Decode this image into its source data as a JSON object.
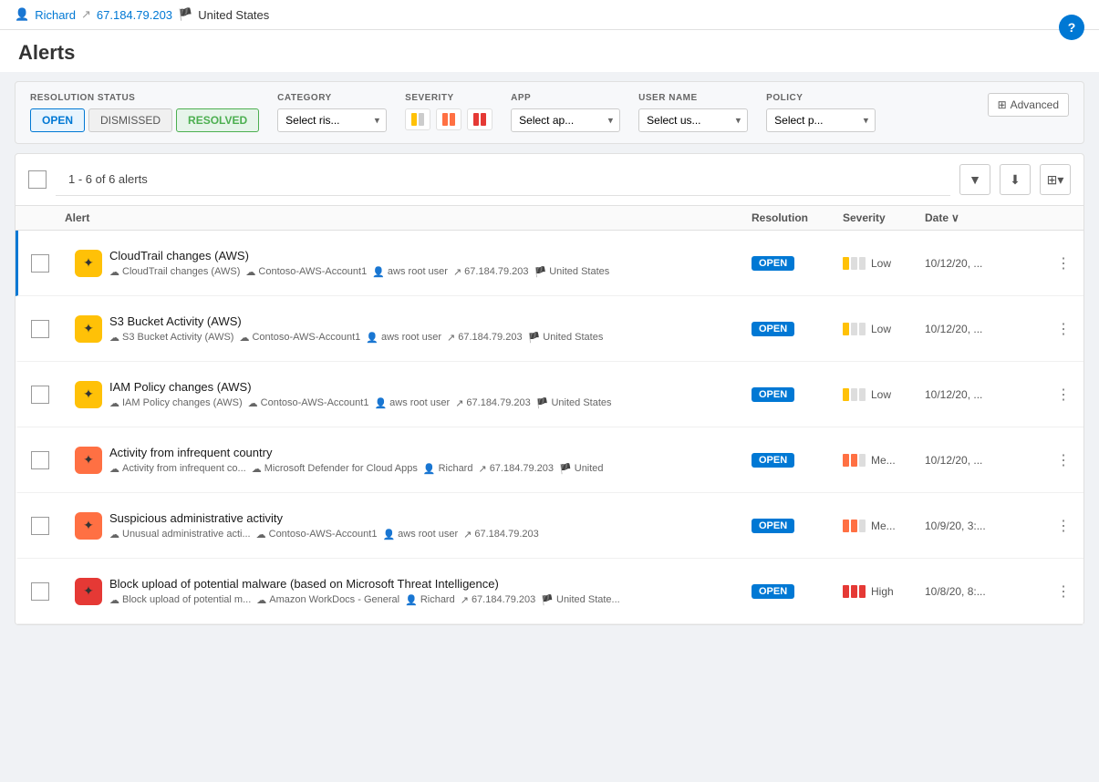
{
  "page": {
    "title": "Alerts",
    "help_label": "?"
  },
  "user": {
    "name": "Richard",
    "ip": "67.184.79.203",
    "location": "United States"
  },
  "filters": {
    "resolution_label": "RESOLUTION STATUS",
    "category_label": "CATEGORY",
    "severity_label": "SEVERITY",
    "app_label": "APP",
    "username_label": "USER NAME",
    "policy_label": "POLICY",
    "advanced_label": "Advanced",
    "open_label": "OPEN",
    "dismissed_label": "DISMISSED",
    "resolved_label": "RESOLVED",
    "category_placeholder": "Select ris...",
    "app_placeholder": "Select ap...",
    "username_placeholder": "Select us...",
    "policy_placeholder": "Select p..."
  },
  "table": {
    "count_text": "1 - 6 of 6 alerts",
    "col_alert": "Alert",
    "col_resolution": "Resolution",
    "col_severity": "Severity",
    "col_date": "Date",
    "alerts": [
      {
        "id": 1,
        "title": "CloudTrail changes (AWS)",
        "meta_policy": "CloudTrail changes (AWS)",
        "meta_app": "Contoso-AWS-Account1",
        "meta_user": "aws root user",
        "meta_ip": "67.184.79.203",
        "meta_location": "United States",
        "resolution": "OPEN",
        "severity": "Low",
        "severity_level": 1,
        "severity_color": "yellow",
        "date": "10/12/20, ...",
        "icon_color": "yellow"
      },
      {
        "id": 2,
        "title": "S3 Bucket Activity (AWS)",
        "meta_policy": "S3 Bucket Activity (AWS)",
        "meta_app": "Contoso-AWS-Account1",
        "meta_user": "aws root user",
        "meta_ip": "67.184.79.203",
        "meta_location": "United States",
        "resolution": "OPEN",
        "severity": "Low",
        "severity_level": 1,
        "severity_color": "yellow",
        "date": "10/12/20, ...",
        "icon_color": "yellow"
      },
      {
        "id": 3,
        "title": "IAM Policy changes (AWS)",
        "meta_policy": "IAM Policy changes (AWS)",
        "meta_app": "Contoso-AWS-Account1",
        "meta_user": "aws root user",
        "meta_ip": "67.184.79.203",
        "meta_location": "United States",
        "resolution": "OPEN",
        "severity": "Low",
        "severity_level": 1,
        "severity_color": "yellow",
        "date": "10/12/20, ...",
        "icon_color": "yellow"
      },
      {
        "id": 4,
        "title": "Activity from infrequent country",
        "meta_policy": "Activity from infrequent co...",
        "meta_app": "Microsoft Defender for Cloud Apps",
        "meta_user": "Richard",
        "meta_ip": "67.184.79.203",
        "meta_location": "United",
        "resolution": "OPEN",
        "severity": "Me...",
        "severity_level": 2,
        "severity_color": "orange",
        "date": "10/12/20, ...",
        "icon_color": "orange"
      },
      {
        "id": 5,
        "title": "Suspicious administrative activity",
        "meta_policy": "Unusual administrative acti...",
        "meta_app": "Contoso-AWS-Account1",
        "meta_user": "aws root user",
        "meta_ip": "67.184.79.203",
        "meta_location": "",
        "resolution": "OPEN",
        "severity": "Me...",
        "severity_level": 2,
        "severity_color": "orange",
        "date": "10/9/20, 3:...",
        "icon_color": "orange"
      },
      {
        "id": 6,
        "title": "Block upload of potential malware (based on Microsoft Threat Intelligence)",
        "meta_policy": "Block upload of potential m...",
        "meta_app": "Amazon WorkDocs - General",
        "meta_user": "Richard",
        "meta_ip": "67.184.79.203",
        "meta_location": "United State...",
        "resolution": "OPEN",
        "severity": "High",
        "severity_level": 3,
        "severity_color": "red",
        "date": "10/8/20, 8:...",
        "icon_color": "red"
      }
    ]
  }
}
